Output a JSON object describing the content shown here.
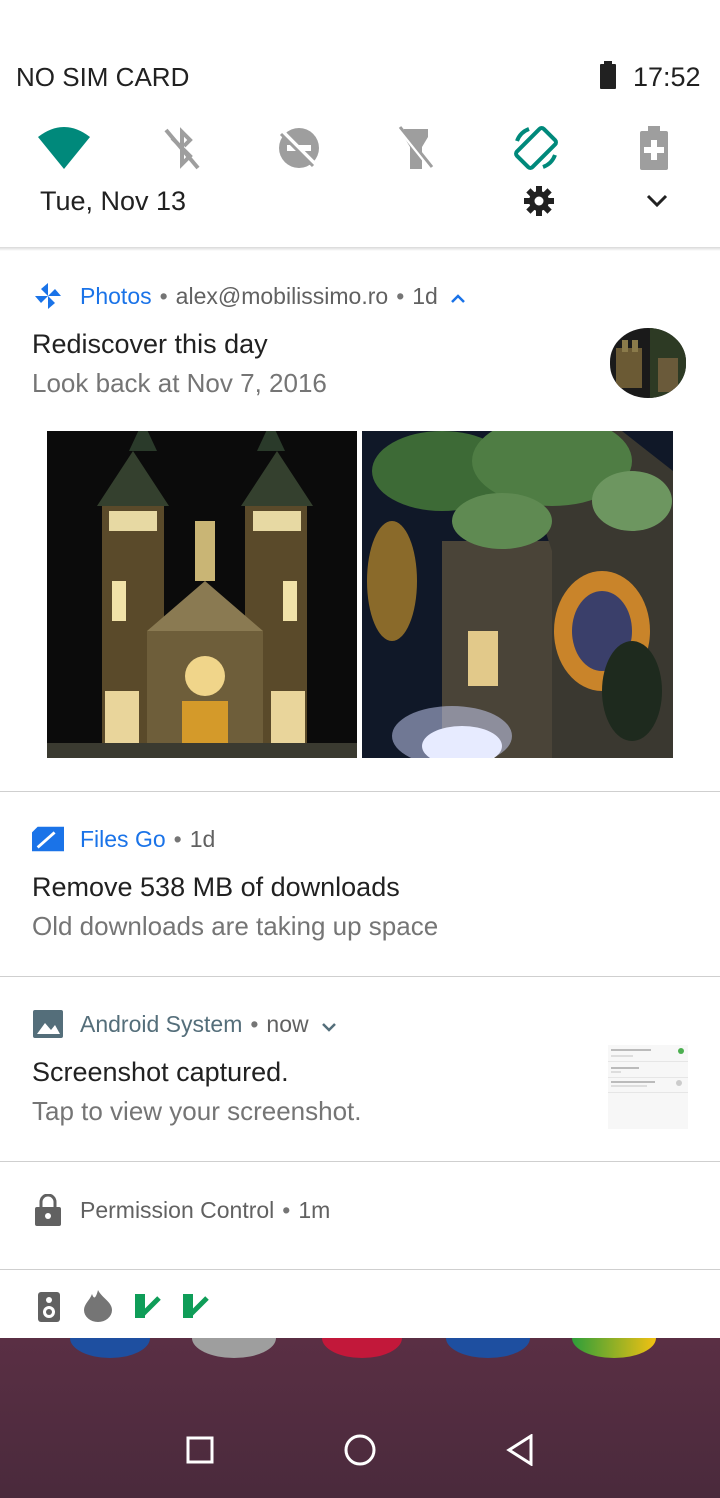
{
  "status": {
    "carrier": "NO SIM CARD",
    "time": "17:52"
  },
  "quick_settings": {
    "date": "Tue, Nov 13",
    "tiles": [
      "wifi-icon",
      "bluetooth-off-icon",
      "dnd-off-icon",
      "flashlight-off-icon",
      "auto-rotate-icon",
      "battery-saver-icon"
    ],
    "accent": "#00897b"
  },
  "notifications": [
    {
      "app": "Photos",
      "account": "alex@mobilissimo.ro",
      "time": "1d",
      "title": "Rediscover this day",
      "text": "Look back at Nov 7, 2016",
      "app_color": "#1a73e8"
    },
    {
      "app": "Files Go",
      "time": "1d",
      "title": "Remove 538 MB of downloads",
      "text": "Old downloads are taking up space",
      "app_color": "#1a73e8"
    },
    {
      "app": "Android System",
      "time": "now",
      "title": "Screenshot captured.",
      "text": "Tap to view your screenshot.",
      "app_color": "#546e7a"
    },
    {
      "app": "Permission Control",
      "time": "1m",
      "app_color": "#616161"
    }
  ],
  "bottom_icons": [
    "speaker-icon",
    "flame-icon",
    "task-check-icon",
    "task-check-icon"
  ],
  "nav": [
    "recents-button",
    "home-button",
    "back-button"
  ]
}
